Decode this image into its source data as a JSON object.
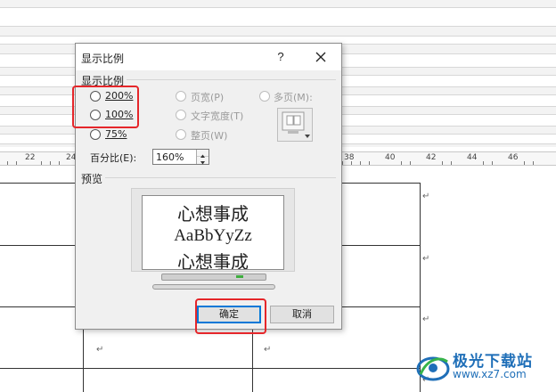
{
  "ruler": {
    "labels": [
      "22",
      "24",
      "38",
      "40",
      "42",
      "44",
      "46"
    ]
  },
  "document": {
    "para_mark": "↵"
  },
  "dialog": {
    "title": "显示比例",
    "help_label": "?",
    "zoom_group_label": "显示比例",
    "options": {
      "p200": "200%",
      "p100": "100%",
      "p75": "75%",
      "page_width": "页宽(P)",
      "text_width": "文字宽度(T)",
      "whole_page": "整页(W)",
      "many_pages": "多页(M):"
    },
    "percent_label": "百分比(E):",
    "percent_value": "160%",
    "preview_label": "预览",
    "preview_lines": [
      "心想事成",
      "AaBbYyZz",
      "心想事成"
    ],
    "ok_label": "确定",
    "cancel_label": "取消"
  },
  "watermark": {
    "name": "极光下载站",
    "url": "www.xz7.com"
  },
  "colors": {
    "highlight": "#e5262a",
    "accent": "#0078d7",
    "watermark": "#1f6fb8"
  }
}
